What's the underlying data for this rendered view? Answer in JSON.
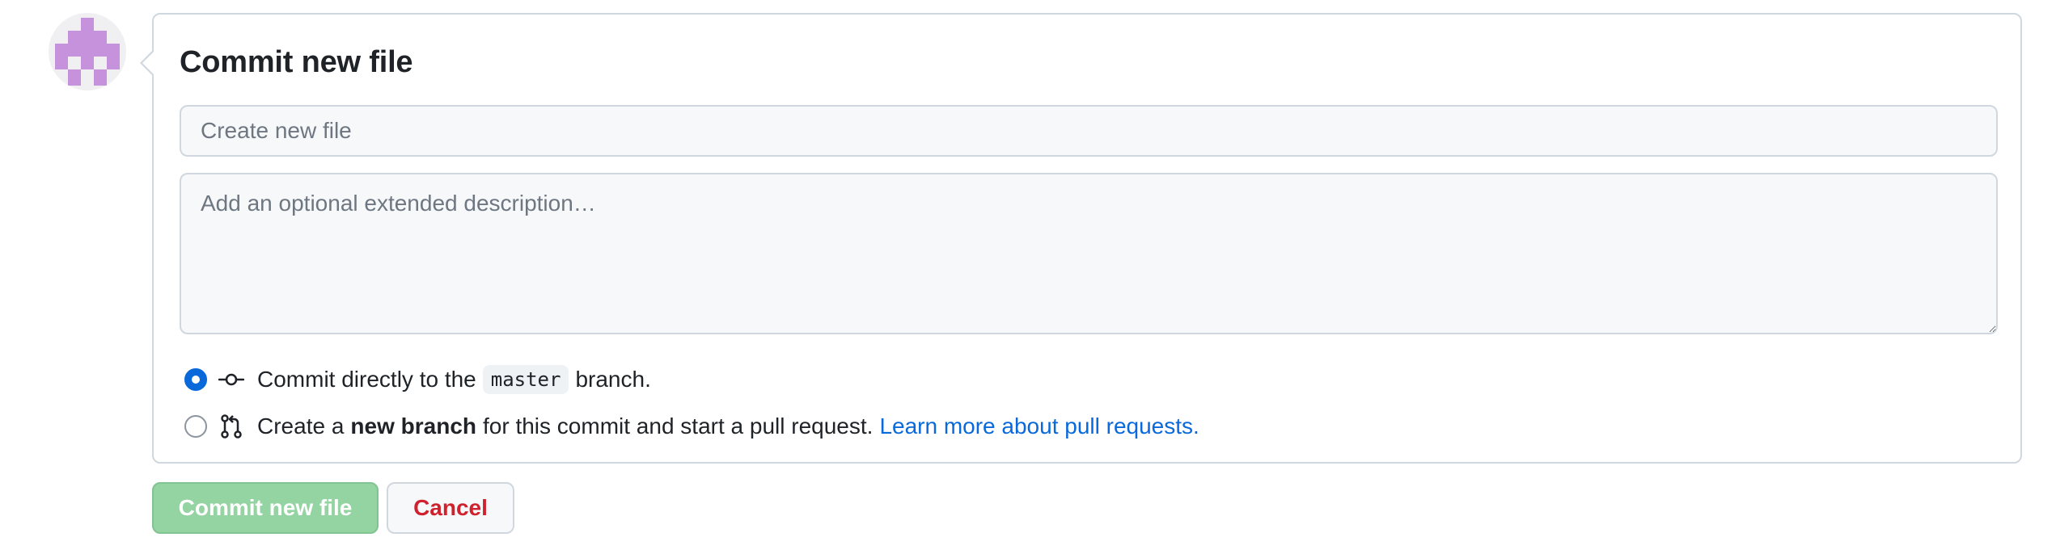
{
  "avatar": {
    "alt": "user avatar",
    "color": "#c792dc"
  },
  "commit_form": {
    "title": "Commit new file",
    "summary_placeholder": "Create new file",
    "summary_value": "",
    "description_placeholder": "Add an optional extended description…",
    "description_value": "",
    "options": {
      "direct": {
        "selected": true,
        "text_before": "Commit directly to the",
        "branch": "master",
        "text_after": "branch."
      },
      "new_branch": {
        "selected": false,
        "text_before": "Create a",
        "bold": "new branch",
        "text_after": "for this commit and start a pull request.",
        "link": "Learn more about pull requests."
      }
    }
  },
  "actions": {
    "commit_label": "Commit new file",
    "commit_disabled": true,
    "cancel_label": "Cancel"
  },
  "colors": {
    "accent": "#0969da",
    "commit_button_disabled": "#94d3a2",
    "cancel_text": "#cf222e",
    "border": "#d0d7de"
  }
}
